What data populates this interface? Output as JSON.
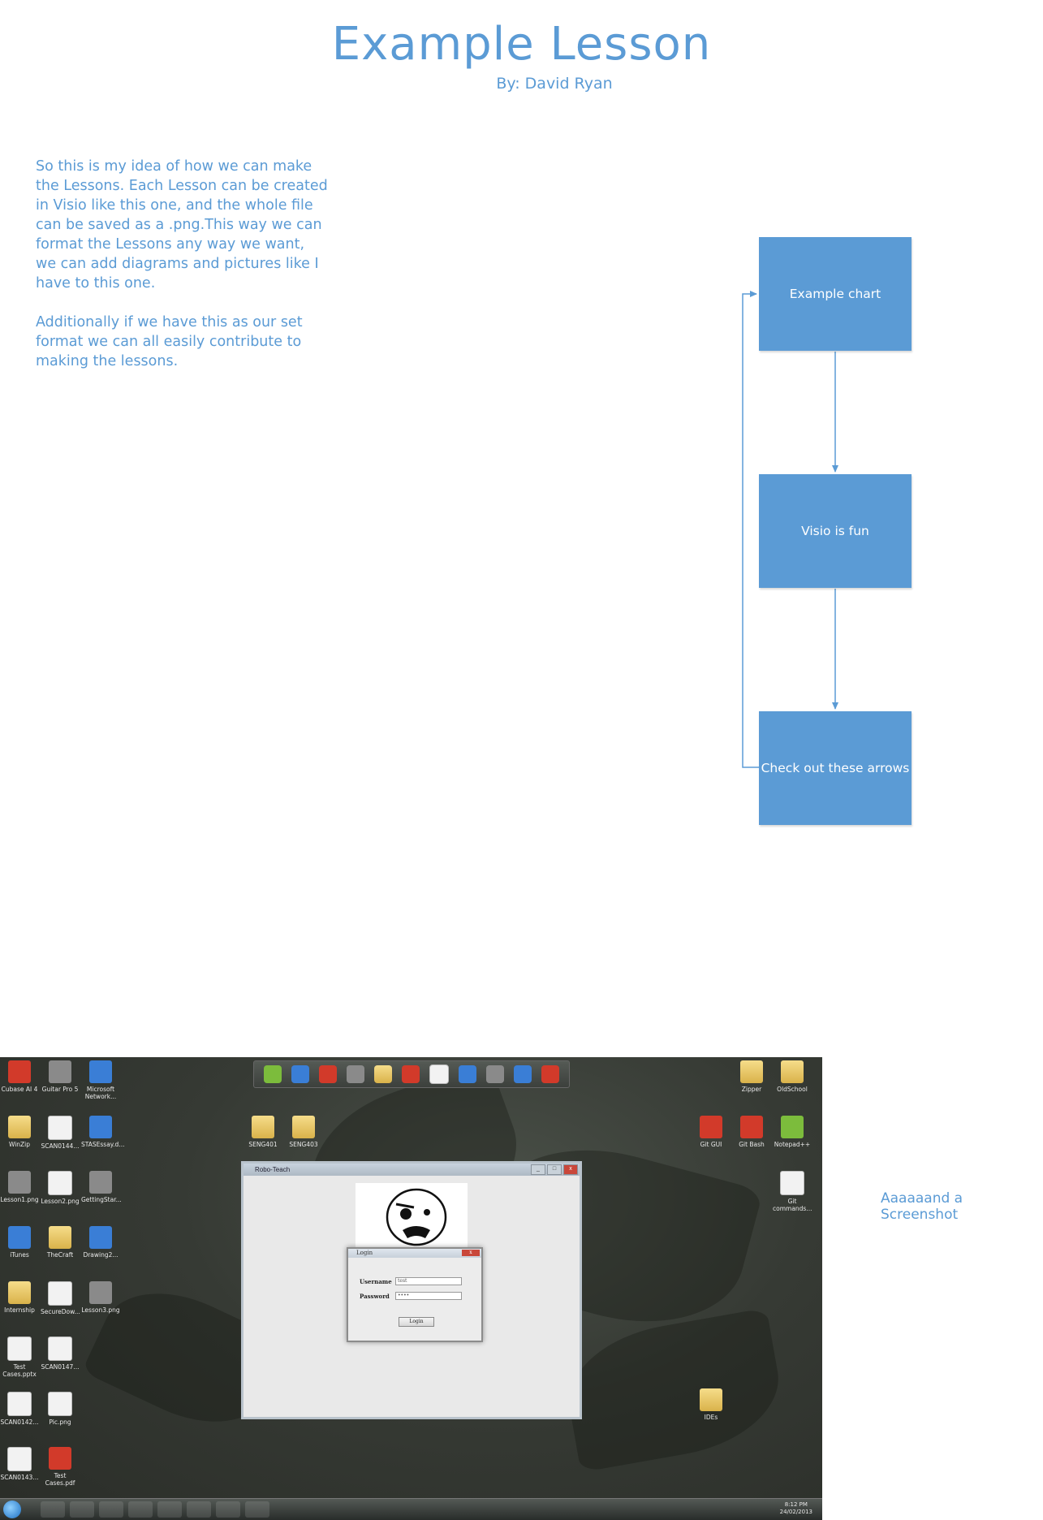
{
  "header": {
    "title": "Example Lesson",
    "author": "By: David Ryan"
  },
  "intro": {
    "paragraph1": "So this is my idea of how we can make the Lessons. Each Lesson can be created in Visio like this one, and the whole file can be saved as a .png.This way we can format the Lessons any way we want, we can add diagrams and pictures like I have to this one.",
    "paragraph2": "Additionally if we have this as our set format we can all easily contribute to making the lessons."
  },
  "flowchart": {
    "nodes": [
      "Example chart",
      "Visio is fun",
      "Check out these arrows"
    ],
    "edges": [
      {
        "from": "Example chart",
        "to": "Visio is fun"
      },
      {
        "from": "Visio is fun",
        "to": "Check out these arrows"
      },
      {
        "from": "Check out these arrows",
        "to": "Example chart"
      }
    ],
    "box_color": "#5b9bd5",
    "line_color": "#5b9bd5"
  },
  "screenshot_caption": "Aaaaaand a Screenshot",
  "desktop": {
    "left_icons": [
      "Cubase AI 4",
      "Guitar Pro 5",
      "Microsoft Network...",
      "WinZip",
      "SCAN0144...",
      "STASEssay.d...",
      "Lesson1.png",
      "Lesson2.png",
      "GettingStar...",
      "iTunes",
      "TheCraft",
      "Drawing2...",
      "Internship",
      "SecureDow...",
      "Lesson3.png",
      "Test Cases.pptx",
      "SCAN0147...",
      "SCAN0142...",
      "Pic.png",
      "SCAN0143...",
      "Test Cases.pdf"
    ],
    "middle_icons": [
      "SENG401",
      "SENG403"
    ],
    "right_icons": [
      "Zipper",
      "OldSchool",
      "Git GUI",
      "Git Bash",
      "Notepad++",
      "Git commands...",
      "IDEs"
    ],
    "app_window_title": "Robo-Teach",
    "login_dialog": {
      "title": "Login",
      "username_label": "Username",
      "username_value": "test",
      "password_label": "Password",
      "password_value": "••••",
      "button_label": "Login"
    },
    "clock_time": "8:12 PM",
    "clock_date": "24/02/2013"
  }
}
